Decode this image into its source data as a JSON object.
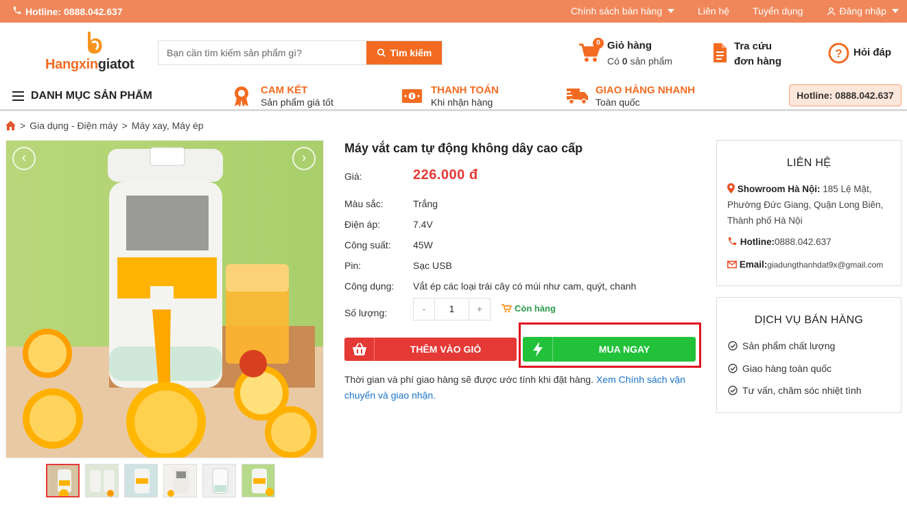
{
  "topbar": {
    "hotline": "Hotline: 0888.042.637",
    "links": [
      "Chính sách bán hàng",
      "Liên hệ",
      "Tuyển dụng",
      "Đăng nhập"
    ]
  },
  "logo": {
    "part1": "Hangxin",
    "part2": "giatot"
  },
  "search": {
    "placeholder": "Bạn cần tìm kiếm sản phẩm gì?",
    "button": "Tìm kiếm"
  },
  "cart": {
    "count": "0",
    "title": "Giỏ hàng",
    "sub_prefix": "Có ",
    "sub_count": "0",
    "sub_suffix": " sản phẩm"
  },
  "lookup": {
    "line1": "Tra cứu",
    "line2": "đơn hàng"
  },
  "faq": {
    "label": "Hỏi đáp"
  },
  "nav": {
    "menu": "DANH MỤC SẢN PHẨM",
    "features": [
      {
        "title": "CAM KẾT",
        "sub": "Sản phẩm giá tốt"
      },
      {
        "title": "THANH TOÁN",
        "sub": "Khi nhận hàng"
      },
      {
        "title": "GIAO HÀNG NHANH",
        "sub": "Toàn quốc"
      }
    ],
    "hotline": "Hotline: 0888.042.637"
  },
  "breadcrumb": [
    "Gia dụng - Điện máy",
    "Máy xay, Máy ép"
  ],
  "gallery": {
    "prev": "‹",
    "next": "›",
    "thumb_count": 6,
    "active_thumb": 1
  },
  "product": {
    "title": "Máy vắt cam tự động không dây cao cấp",
    "price_label": "Giá:",
    "price": "226.000 đ",
    "specs": [
      {
        "label": "Màu sắc:",
        "value": "Trắng"
      },
      {
        "label": "Điện áp:",
        "value": "7.4V"
      },
      {
        "label": "Công suất:",
        "value": "45W"
      },
      {
        "label": "Pin:",
        "value": "Sạc USB"
      },
      {
        "label": "Công dụng:",
        "value": "Vắt ép các loại trái cây có múi như cam, quýt, chanh"
      }
    ],
    "qty_label": "Số lượng:",
    "qty_minus": "-",
    "qty_value": "1",
    "qty_plus": "+",
    "stock": "Còn hàng",
    "add_cart": "THÊM VÀO GIỎ",
    "buy_now": "MUA NGAY",
    "ship_text": "Thời gian và phí giao hàng sẽ được ước tính khi đặt hàng. ",
    "ship_link": "Xem Chính sách vận chuyển và giao nhận."
  },
  "contact": {
    "title": "LIÊN HỆ",
    "showroom_label": "Showroom Hà Nội:",
    "showroom_value": " 185 Lệ Mật, Phường Đức Giang, Quận Long Biên, Thành phố Hà Nội",
    "hotline_label": "Hotline:",
    "hotline_value": "0888.042.637",
    "email_label": "Email:",
    "email_value": "giadungthanhdat9x@gmail.com"
  },
  "services": {
    "title": "DỊCH VỤ BÁN HÀNG",
    "items": [
      "Sản phẩm chất lượng",
      "Giao hàng toàn quốc",
      "Tư vấn, chăm sóc nhiệt tình"
    ]
  },
  "colors": {
    "orange": "#f26b21",
    "topbar": "#f0875a",
    "red": "#e53935",
    "green": "#22c13a"
  }
}
